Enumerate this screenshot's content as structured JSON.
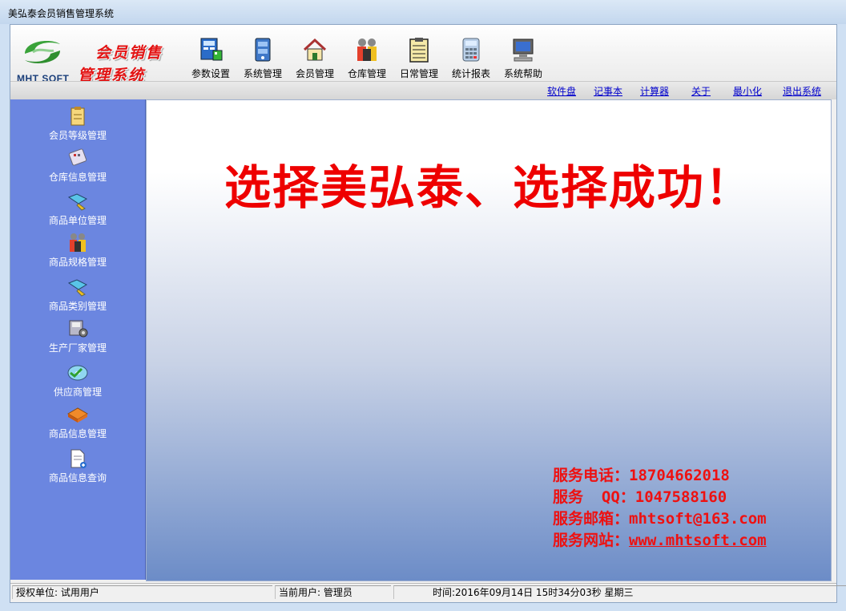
{
  "window": {
    "title": "美弘泰会员销售管理系统"
  },
  "logo": {
    "brand": "MHT SOFT",
    "line1": "会员销售",
    "line2": "管理系统"
  },
  "toolbar": [
    {
      "label": "参数设置",
      "icon": "settings-icon"
    },
    {
      "label": "系统管理",
      "icon": "system-cabinet-icon"
    },
    {
      "label": "会员管理",
      "icon": "home-icon"
    },
    {
      "label": "仓库管理",
      "icon": "people-icon"
    },
    {
      "label": "日常管理",
      "icon": "clipboard-icon"
    },
    {
      "label": "统计报表",
      "icon": "calculator-icon"
    },
    {
      "label": "系统帮助",
      "icon": "computer-icon"
    }
  ],
  "links": [
    "软件盘",
    "记事本",
    "计算器",
    "关于",
    "最小化",
    "退出系统"
  ],
  "sidebar": [
    {
      "label": "会员等级管理",
      "icon": "clipboard-icon"
    },
    {
      "label": "仓库信息管理",
      "icon": "calculator-icon"
    },
    {
      "label": "商品单位管理",
      "icon": "map-pen-icon"
    },
    {
      "label": "商品规格管理",
      "icon": "people-icon"
    },
    {
      "label": "商品类别管理",
      "icon": "map-pen-icon"
    },
    {
      "label": "生产厂家管理",
      "icon": "disk-gear-icon"
    },
    {
      "label": "供应商管理",
      "icon": "cd-check-icon"
    },
    {
      "label": "商品信息管理",
      "icon": "box-icon"
    },
    {
      "label": "商品信息查询",
      "icon": "document-add-icon"
    }
  ],
  "main": {
    "slogan": "选择美弘泰、选择成功！",
    "contact": {
      "phone_label": "服务电话：",
      "phone": "18704662018",
      "qq_label": "服务  QQ：",
      "qq": "1047588160",
      "email_label": "服务邮箱：",
      "email": "mhtsoft@163.com",
      "site_label": "服务网站：",
      "site": "www.mhtsoft.com"
    }
  },
  "status": {
    "licensee": "授权单位: 试用用户",
    "user": "当前用户: 管理员",
    "time": "时间:2016年09月14日 15时34分03秒 星期三"
  },
  "colors": {
    "slogan": "#ee0000",
    "sidebar": "#6b86e0",
    "link": "#0000cc"
  }
}
